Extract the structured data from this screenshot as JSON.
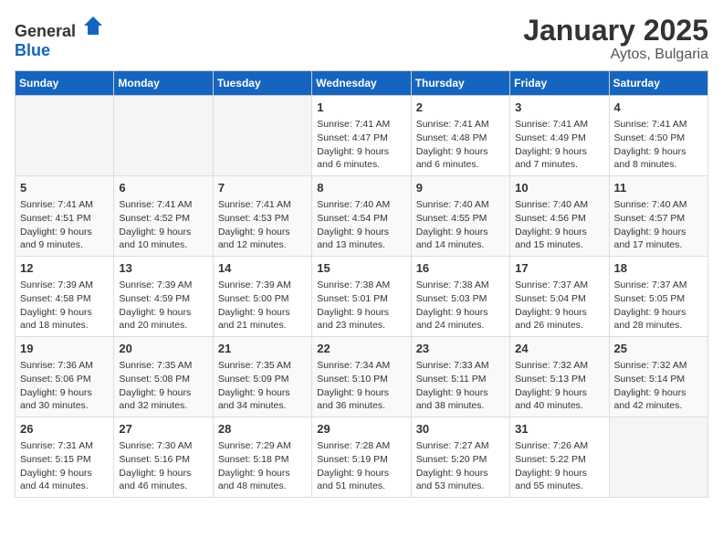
{
  "header": {
    "logo_general": "General",
    "logo_blue": "Blue",
    "title": "January 2025",
    "subtitle": "Aytos, Bulgaria"
  },
  "days_of_week": [
    "Sunday",
    "Monday",
    "Tuesday",
    "Wednesday",
    "Thursday",
    "Friday",
    "Saturday"
  ],
  "weeks": [
    [
      {
        "day": "",
        "content": ""
      },
      {
        "day": "",
        "content": ""
      },
      {
        "day": "",
        "content": ""
      },
      {
        "day": "1",
        "content": "Sunrise: 7:41 AM\nSunset: 4:47 PM\nDaylight: 9 hours\nand 6 minutes."
      },
      {
        "day": "2",
        "content": "Sunrise: 7:41 AM\nSunset: 4:48 PM\nDaylight: 9 hours\nand 6 minutes."
      },
      {
        "day": "3",
        "content": "Sunrise: 7:41 AM\nSunset: 4:49 PM\nDaylight: 9 hours\nand 7 minutes."
      },
      {
        "day": "4",
        "content": "Sunrise: 7:41 AM\nSunset: 4:50 PM\nDaylight: 9 hours\nand 8 minutes."
      }
    ],
    [
      {
        "day": "5",
        "content": "Sunrise: 7:41 AM\nSunset: 4:51 PM\nDaylight: 9 hours\nand 9 minutes."
      },
      {
        "day": "6",
        "content": "Sunrise: 7:41 AM\nSunset: 4:52 PM\nDaylight: 9 hours\nand 10 minutes."
      },
      {
        "day": "7",
        "content": "Sunrise: 7:41 AM\nSunset: 4:53 PM\nDaylight: 9 hours\nand 12 minutes."
      },
      {
        "day": "8",
        "content": "Sunrise: 7:40 AM\nSunset: 4:54 PM\nDaylight: 9 hours\nand 13 minutes."
      },
      {
        "day": "9",
        "content": "Sunrise: 7:40 AM\nSunset: 4:55 PM\nDaylight: 9 hours\nand 14 minutes."
      },
      {
        "day": "10",
        "content": "Sunrise: 7:40 AM\nSunset: 4:56 PM\nDaylight: 9 hours\nand 15 minutes."
      },
      {
        "day": "11",
        "content": "Sunrise: 7:40 AM\nSunset: 4:57 PM\nDaylight: 9 hours\nand 17 minutes."
      }
    ],
    [
      {
        "day": "12",
        "content": "Sunrise: 7:39 AM\nSunset: 4:58 PM\nDaylight: 9 hours\nand 18 minutes."
      },
      {
        "day": "13",
        "content": "Sunrise: 7:39 AM\nSunset: 4:59 PM\nDaylight: 9 hours\nand 20 minutes."
      },
      {
        "day": "14",
        "content": "Sunrise: 7:39 AM\nSunset: 5:00 PM\nDaylight: 9 hours\nand 21 minutes."
      },
      {
        "day": "15",
        "content": "Sunrise: 7:38 AM\nSunset: 5:01 PM\nDaylight: 9 hours\nand 23 minutes."
      },
      {
        "day": "16",
        "content": "Sunrise: 7:38 AM\nSunset: 5:03 PM\nDaylight: 9 hours\nand 24 minutes."
      },
      {
        "day": "17",
        "content": "Sunrise: 7:37 AM\nSunset: 5:04 PM\nDaylight: 9 hours\nand 26 minutes."
      },
      {
        "day": "18",
        "content": "Sunrise: 7:37 AM\nSunset: 5:05 PM\nDaylight: 9 hours\nand 28 minutes."
      }
    ],
    [
      {
        "day": "19",
        "content": "Sunrise: 7:36 AM\nSunset: 5:06 PM\nDaylight: 9 hours\nand 30 minutes."
      },
      {
        "day": "20",
        "content": "Sunrise: 7:35 AM\nSunset: 5:08 PM\nDaylight: 9 hours\nand 32 minutes."
      },
      {
        "day": "21",
        "content": "Sunrise: 7:35 AM\nSunset: 5:09 PM\nDaylight: 9 hours\nand 34 minutes."
      },
      {
        "day": "22",
        "content": "Sunrise: 7:34 AM\nSunset: 5:10 PM\nDaylight: 9 hours\nand 36 minutes."
      },
      {
        "day": "23",
        "content": "Sunrise: 7:33 AM\nSunset: 5:11 PM\nDaylight: 9 hours\nand 38 minutes."
      },
      {
        "day": "24",
        "content": "Sunrise: 7:32 AM\nSunset: 5:13 PM\nDaylight: 9 hours\nand 40 minutes."
      },
      {
        "day": "25",
        "content": "Sunrise: 7:32 AM\nSunset: 5:14 PM\nDaylight: 9 hours\nand 42 minutes."
      }
    ],
    [
      {
        "day": "26",
        "content": "Sunrise: 7:31 AM\nSunset: 5:15 PM\nDaylight: 9 hours\nand 44 minutes."
      },
      {
        "day": "27",
        "content": "Sunrise: 7:30 AM\nSunset: 5:16 PM\nDaylight: 9 hours\nand 46 minutes."
      },
      {
        "day": "28",
        "content": "Sunrise: 7:29 AM\nSunset: 5:18 PM\nDaylight: 9 hours\nand 48 minutes."
      },
      {
        "day": "29",
        "content": "Sunrise: 7:28 AM\nSunset: 5:19 PM\nDaylight: 9 hours\nand 51 minutes."
      },
      {
        "day": "30",
        "content": "Sunrise: 7:27 AM\nSunset: 5:20 PM\nDaylight: 9 hours\nand 53 minutes."
      },
      {
        "day": "31",
        "content": "Sunrise: 7:26 AM\nSunset: 5:22 PM\nDaylight: 9 hours\nand 55 minutes."
      },
      {
        "day": "",
        "content": ""
      }
    ]
  ]
}
